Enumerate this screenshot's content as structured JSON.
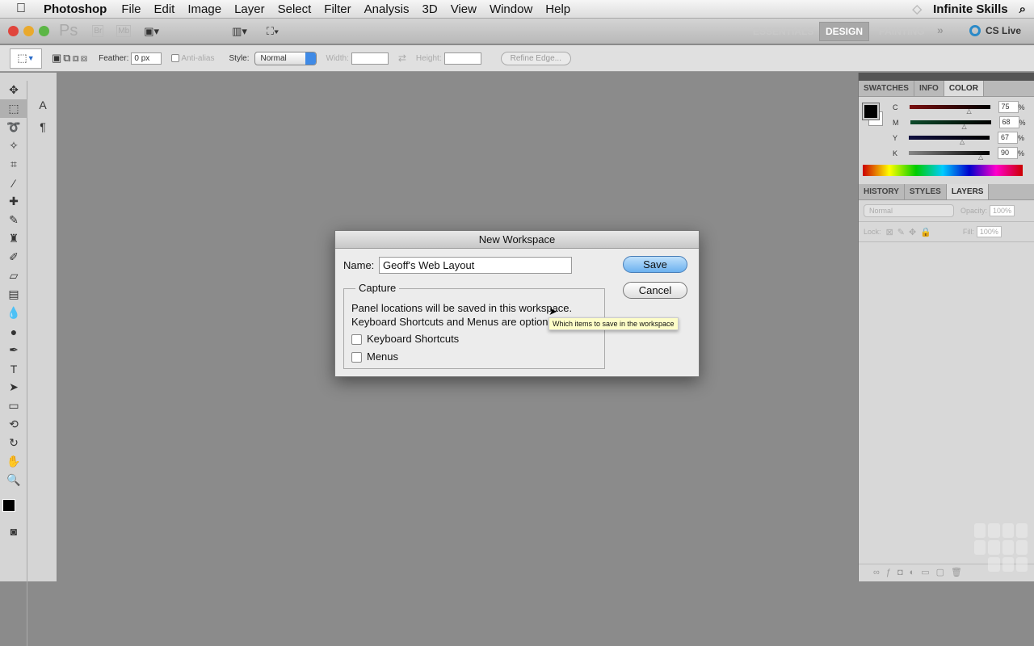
{
  "menubar": {
    "app": "Photoshop",
    "items": [
      "File",
      "Edit",
      "Image",
      "Layer",
      "Select",
      "Filter",
      "Analysis",
      "3D",
      "View",
      "Window",
      "Help"
    ],
    "brand": "Infinite Skills"
  },
  "appbar": {
    "ps": "Ps",
    "br": "Br",
    "mb": "Mb",
    "workspaces": [
      "ESSENTIALS",
      "DESIGN",
      "PAINTING"
    ],
    "active_workspace": "DESIGN",
    "more": "»",
    "cs_live": "CS Live"
  },
  "options": {
    "feather_label": "Feather:",
    "feather_value": "0 px",
    "antialias": "Anti-alias",
    "style_label": "Style:",
    "style_value": "Normal",
    "width_label": "Width:",
    "height_label": "Height:",
    "refine_edge": "Refine Edge..."
  },
  "color_panel": {
    "tabs": [
      "SWATCHES",
      "INFO",
      "COLOR"
    ],
    "active": "COLOR",
    "channels": [
      {
        "label": "C",
        "value": "75",
        "color": "#7a1010"
      },
      {
        "label": "M",
        "value": "68",
        "color": "#0d4a2a"
      },
      {
        "label": "Y",
        "value": "67",
        "color": "#101040"
      },
      {
        "label": "K",
        "value": "90",
        "color": "#777777"
      }
    ],
    "unit": "%"
  },
  "layers_panel": {
    "tabs": [
      "HISTORY",
      "STYLES",
      "LAYERS"
    ],
    "active": "LAYERS",
    "blend": "Normal",
    "opacity_label": "Opacity:",
    "opacity": "100%",
    "lock_label": "Lock:",
    "fill_label": "Fill:",
    "fill": "100%"
  },
  "dialog": {
    "title": "New Workspace",
    "name_label": "Name:",
    "name_value": "Geoff's Web Layout",
    "save": "Save",
    "cancel": "Cancel",
    "group": "Capture",
    "line1": "Panel locations will be saved in this workspace.",
    "line2": "Keyboard Shortcuts and Menus are optional.",
    "opt_shortcuts": "Keyboard Shortcuts",
    "opt_menus": "Menus",
    "tooltip": "Which items to save in the workspace"
  }
}
